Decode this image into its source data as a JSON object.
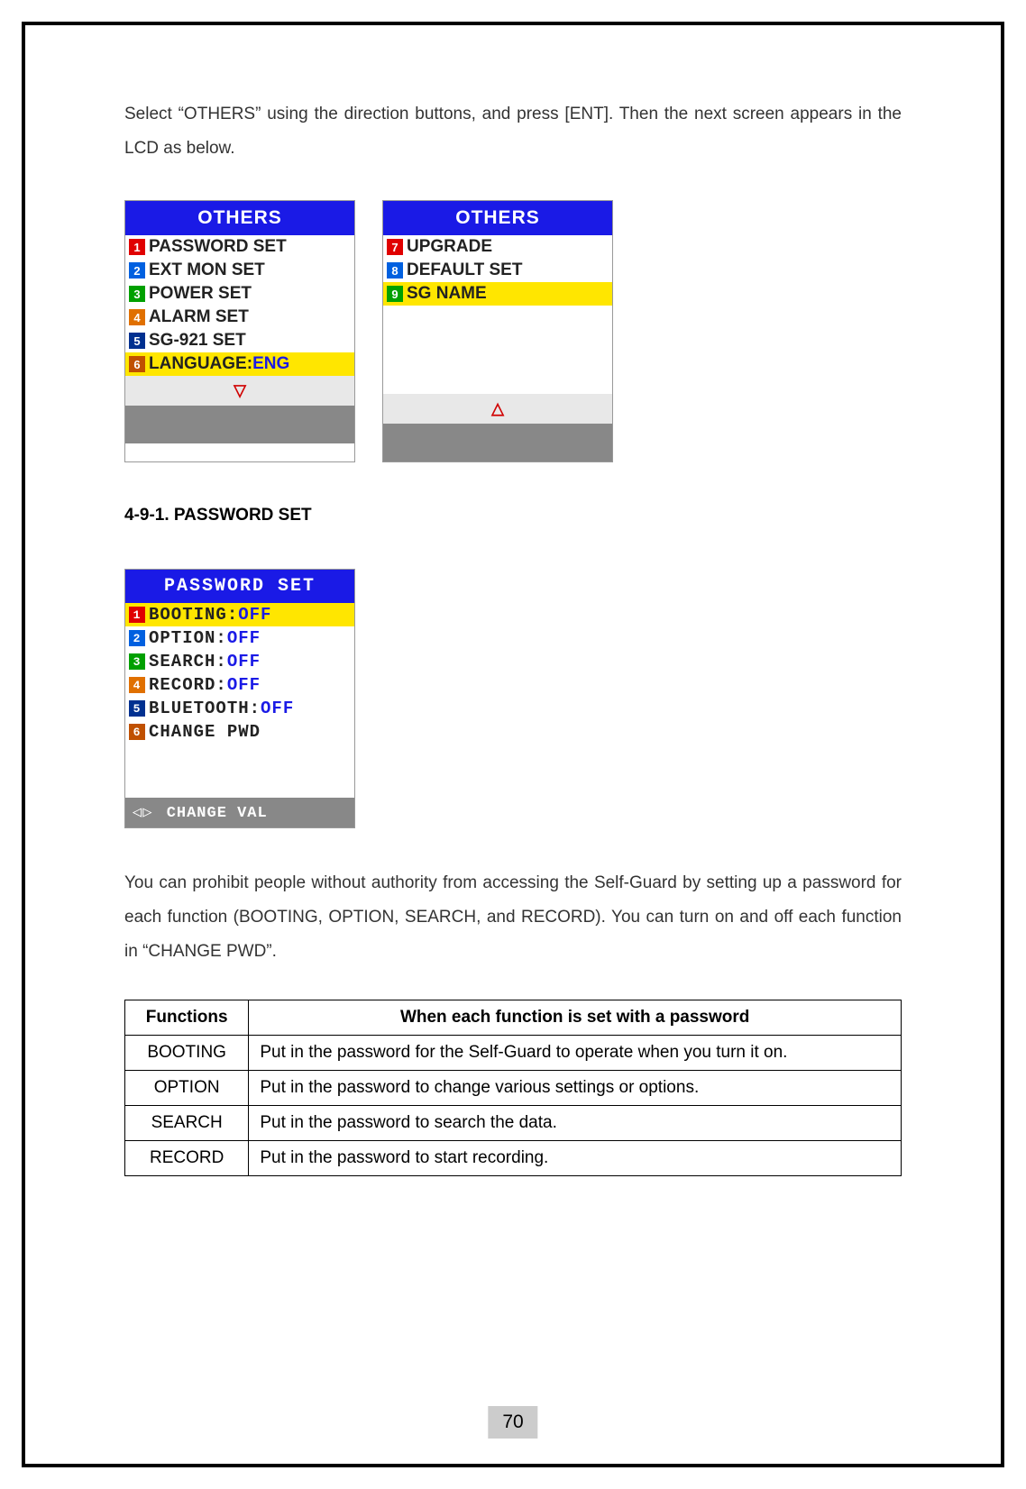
{
  "intro": "Select “OTHERS” using the direction buttons, and press [ENT]. Then the next screen appears in the LCD as below.",
  "lcd1": {
    "title": "OTHERS",
    "items": [
      {
        "num": "1",
        "label": "PASSWORD SET",
        "val": "",
        "highlight": false,
        "numclass": "n-red"
      },
      {
        "num": "2",
        "label": "EXT MON SET",
        "val": "",
        "highlight": false,
        "numclass": "n-blue"
      },
      {
        "num": "3",
        "label": "POWER SET",
        "val": "",
        "highlight": false,
        "numclass": "n-green"
      },
      {
        "num": "4",
        "label": "ALARM SET",
        "val": "",
        "highlight": false,
        "numclass": "n-orange"
      },
      {
        "num": "5",
        "label": "SG-921 SET",
        "val": "",
        "highlight": false,
        "numclass": "n-dblue"
      },
      {
        "num": "6",
        "label": "LANGUAGE:",
        "val": "ENG",
        "highlight": true,
        "numclass": "n-dorange"
      }
    ],
    "arrow": "▽"
  },
  "lcd2": {
    "title": "OTHERS",
    "items": [
      {
        "num": "7",
        "label": "UPGRADE",
        "val": "",
        "highlight": false,
        "numclass": "n-red"
      },
      {
        "num": "8",
        "label": "DEFAULT SET",
        "val": "",
        "highlight": false,
        "numclass": "n-blue"
      },
      {
        "num": "9",
        "label": "SG NAME",
        "val": "",
        "highlight": true,
        "numclass": "n-green"
      }
    ],
    "arrow": "△"
  },
  "section_title": "4-9-1. PASSWORD SET",
  "lcd3": {
    "title": "PASSWORD SET",
    "items": [
      {
        "num": "1",
        "label": "BOOTING:",
        "val": "OFF",
        "highlight": true,
        "numclass": "n-red"
      },
      {
        "num": "2",
        "label": "OPTION:",
        "val": "OFF",
        "highlight": false,
        "numclass": "n-blue"
      },
      {
        "num": "3",
        "label": "SEARCH:",
        "val": "OFF",
        "highlight": false,
        "numclass": "n-green"
      },
      {
        "num": "4",
        "label": "RECORD:",
        "val": "OFF",
        "highlight": false,
        "numclass": "n-orange"
      },
      {
        "num": "5",
        "label": "BLUETOOTH:",
        "val": "OFF",
        "highlight": false,
        "numclass": "n-dblue"
      },
      {
        "num": "6",
        "label": "CHANGE PWD",
        "val": "",
        "highlight": false,
        "numclass": "n-dorange"
      }
    ],
    "footer": "CHANGE VAL",
    "footer_icon": "◁▷"
  },
  "desc": "You can prohibit people without authority from accessing the Self-Guard by setting up a password for each function (BOOTING, OPTION, SEARCH, and RECORD).    You can turn on and off each function in “CHANGE PWD”.",
  "table": {
    "head": [
      "Functions",
      "When each function is set with a password"
    ],
    "rows": [
      [
        "BOOTING",
        "Put in the password for the Self-Guard to operate when you turn it on."
      ],
      [
        "OPTION",
        "Put in the password to change various settings or options."
      ],
      [
        "SEARCH",
        "Put in the password to search the data."
      ],
      [
        "RECORD",
        "Put in the password to start recording."
      ]
    ]
  },
  "page_num": "70"
}
